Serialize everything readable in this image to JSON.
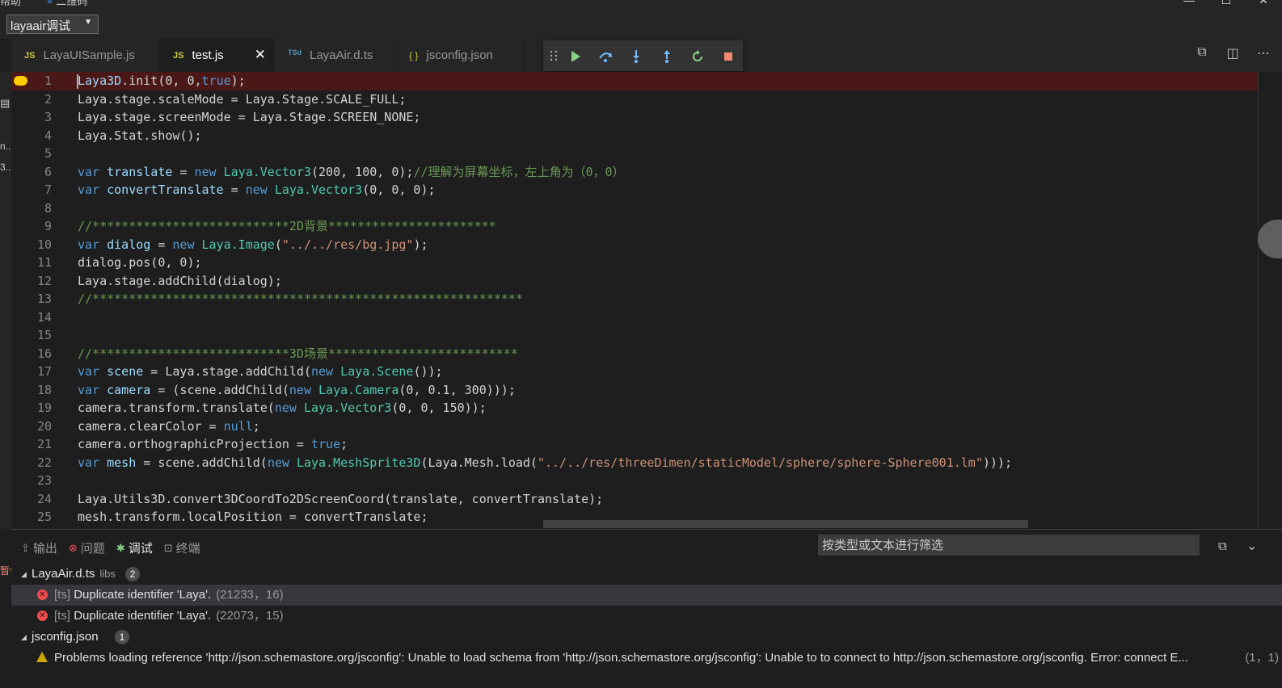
{
  "menubar": {
    "help": "帮助",
    "qrcode": "二维码"
  },
  "debug_config": {
    "selected": "layaair调试"
  },
  "tabs": [
    {
      "type": "JS",
      "label": "LayaUISample.js",
      "active": false
    },
    {
      "type": "JS",
      "label": "test.js",
      "active": true
    },
    {
      "type": "TSd",
      "label": "LayaAir.d.ts",
      "active": false
    },
    {
      "type": "{ }",
      "label": "jsconfig.json",
      "active": false
    }
  ],
  "editor": {
    "current_line": 1,
    "lines": [
      {
        "n": "1",
        "tokens": [
          [
            "v",
            "Laya3D"
          ],
          [
            "p",
            ".init(0, 0,"
          ],
          [
            "k",
            "true"
          ],
          [
            "p",
            ");"
          ]
        ]
      },
      {
        "n": "2",
        "tokens": [
          [
            "p",
            "Laya.stage.scaleMode = Laya.Stage.SCALE_FULL;"
          ]
        ]
      },
      {
        "n": "3",
        "tokens": [
          [
            "p",
            "Laya.stage.screenMode = Laya.Stage.SCREEN_NONE;"
          ]
        ]
      },
      {
        "n": "4",
        "tokens": [
          [
            "p",
            "Laya.Stat.show();"
          ]
        ]
      },
      {
        "n": "5",
        "tokens": []
      },
      {
        "n": "6",
        "tokens": [
          [
            "k",
            "var "
          ],
          [
            "v",
            "translate"
          ],
          [
            "p",
            " = "
          ],
          [
            "k",
            "new "
          ],
          [
            "t",
            "Laya.Vector3"
          ],
          [
            "p",
            "(200, 100, 0);"
          ],
          [
            "c",
            "//理解为屏幕坐标，左上角为（0，0）"
          ]
        ]
      },
      {
        "n": "7",
        "tokens": [
          [
            "k",
            "var "
          ],
          [
            "v",
            "convertTranslate"
          ],
          [
            "p",
            " = "
          ],
          [
            "k",
            "new "
          ],
          [
            "t",
            "Laya.Vector3"
          ],
          [
            "p",
            "(0, 0, 0);"
          ]
        ]
      },
      {
        "n": "8",
        "tokens": []
      },
      {
        "n": "9",
        "tokens": [
          [
            "c",
            "//***************************2D背景***********************"
          ]
        ]
      },
      {
        "n": "10",
        "tokens": [
          [
            "k",
            "var "
          ],
          [
            "v",
            "dialog"
          ],
          [
            "p",
            " = "
          ],
          [
            "k",
            "new "
          ],
          [
            "t",
            "Laya.Image"
          ],
          [
            "p",
            "("
          ],
          [
            "s",
            "\"../../res/bg.jpg\""
          ],
          [
            "p",
            ");"
          ]
        ]
      },
      {
        "n": "11",
        "tokens": [
          [
            "p",
            "dialog.pos(0, 0);"
          ]
        ]
      },
      {
        "n": "12",
        "tokens": [
          [
            "p",
            "Laya.stage.addChild(dialog);"
          ]
        ]
      },
      {
        "n": "13",
        "tokens": [
          [
            "c",
            "//***********************************************************"
          ]
        ]
      },
      {
        "n": "14",
        "tokens": []
      },
      {
        "n": "15",
        "tokens": []
      },
      {
        "n": "16",
        "tokens": [
          [
            "c",
            "//***************************3D场景**************************"
          ]
        ]
      },
      {
        "n": "17",
        "tokens": [
          [
            "k",
            "var "
          ],
          [
            "v",
            "scene"
          ],
          [
            "p",
            " = Laya.stage.addChild("
          ],
          [
            "k",
            "new "
          ],
          [
            "t",
            "Laya.Scene"
          ],
          [
            "p",
            "());"
          ]
        ]
      },
      {
        "n": "18",
        "tokens": [
          [
            "k",
            "var "
          ],
          [
            "v",
            "camera"
          ],
          [
            "p",
            " = (scene.addChild("
          ],
          [
            "k",
            "new "
          ],
          [
            "t",
            "Laya.Camera"
          ],
          [
            "p",
            "(0, 0.1, 300)));"
          ]
        ]
      },
      {
        "n": "19",
        "tokens": [
          [
            "p",
            "camera.transform.translate("
          ],
          [
            "k",
            "new "
          ],
          [
            "t",
            "Laya.Vector3"
          ],
          [
            "p",
            "(0, 0, 150));"
          ]
        ]
      },
      {
        "n": "20",
        "tokens": [
          [
            "p",
            "camera.clearColor = "
          ],
          [
            "k",
            "null"
          ],
          [
            "p",
            ";"
          ]
        ]
      },
      {
        "n": "21",
        "tokens": [
          [
            "p",
            "camera.orthographicProjection = "
          ],
          [
            "k",
            "true"
          ],
          [
            "p",
            ";"
          ]
        ]
      },
      {
        "n": "22",
        "tokens": [
          [
            "k",
            "var "
          ],
          [
            "v",
            "mesh"
          ],
          [
            "p",
            " = scene.addChild("
          ],
          [
            "k",
            "new "
          ],
          [
            "t",
            "Laya.MeshSprite3D"
          ],
          [
            "p",
            "(Laya.Mesh.load("
          ],
          [
            "s",
            "\"../../res/threeDimen/staticModel/sphere/sphere-Sphere001.lm\""
          ],
          [
            "p",
            ")));"
          ]
        ]
      },
      {
        "n": "23",
        "tokens": []
      },
      {
        "n": "24",
        "tokens": [
          [
            "p",
            "Laya.Utils3D.convert3DCoordTo2DScreenCoord(translate, convertTranslate);"
          ]
        ]
      },
      {
        "n": "25",
        "tokens": [
          [
            "p",
            "mesh.transform.localPosition = convertTranslate;"
          ]
        ]
      }
    ]
  },
  "panel": {
    "tabs": [
      {
        "icon": "output-icon",
        "label": "输出",
        "active": false
      },
      {
        "icon": "problems-icon",
        "label": "问题",
        "active": false
      },
      {
        "icon": "debug-icon",
        "label": "调试",
        "active": true
      },
      {
        "icon": "terminal-icon",
        "label": "终端",
        "active": false
      }
    ],
    "filter_placeholder": "按类型或文本进行筛选",
    "groups": [
      {
        "file": "LayaAir.d.ts",
        "dir": "libs",
        "count": "2",
        "items": [
          {
            "severity": "error",
            "source": "[ts]",
            "message": "Duplicate identifier 'Laya'.",
            "location": "(21233，16)"
          },
          {
            "severity": "error",
            "source": "[ts]",
            "message": "Duplicate identifier 'Laya'.",
            "location": "(22073，15)"
          }
        ]
      },
      {
        "file": "jsconfig.json",
        "dir": "",
        "count": "1",
        "items": [
          {
            "severity": "warning",
            "source": "",
            "message": "Problems loading reference 'http://json.schemastore.org/jsconfig': Unable to load schema from 'http://json.schemastore.org/jsconfig': Unable to to connect to http://json.schemastore.org/jsconfig. Error: connect E...",
            "location": "(1，1)"
          }
        ]
      }
    ]
  },
  "left_strip": {
    "frag1": "n...",
    "frag2": "3...",
    "frag3": "暂停"
  },
  "colors": {
    "keyword": "#569cd6",
    "variable": "#9cdcfe",
    "string": "#ce9178",
    "type": "#4ec9b0",
    "comment": "#6a9955",
    "current_line": "#4b1818",
    "breakpoint": "#ffcc00",
    "error": "#f14c4c",
    "warning": "#cca700"
  }
}
